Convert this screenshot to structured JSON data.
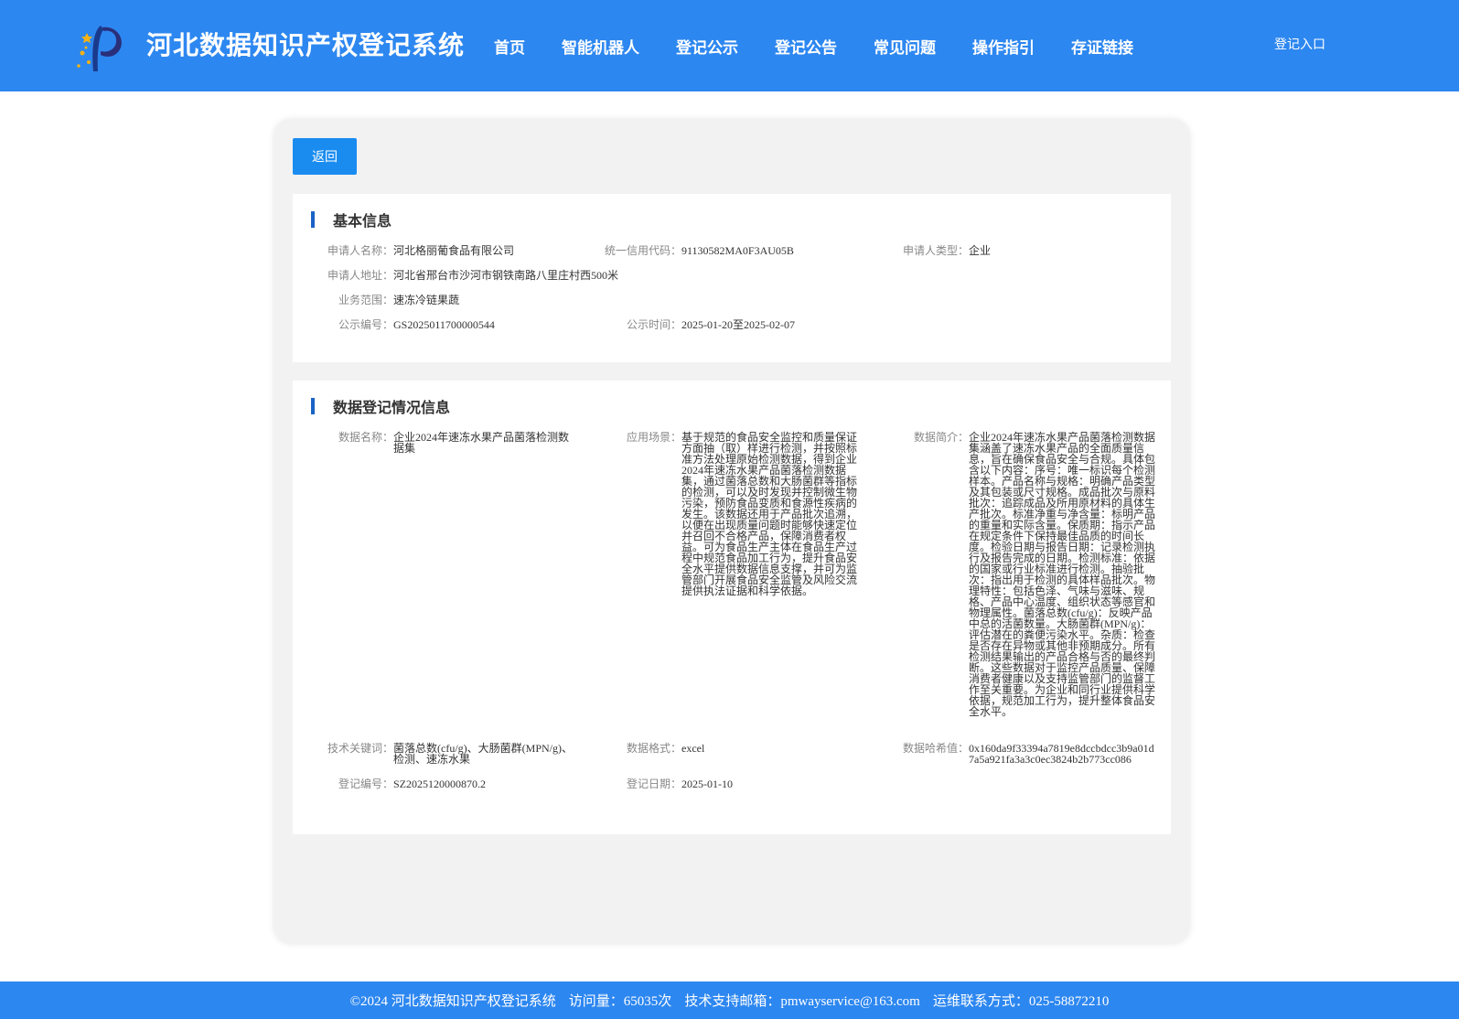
{
  "header": {
    "title": "河北数据知识产权登记系统",
    "nav": [
      "首页",
      "智能机器人",
      "登记公示",
      "登记公告",
      "常见问题",
      "操作指引",
      "存证链接"
    ],
    "login": "登记入口",
    "bg_color": "#2d87f0"
  },
  "back_label": "返回",
  "basic": {
    "title": "基本信息",
    "applicant_name_label": "申请人名称：",
    "applicant_name": "河北格丽葡食品有限公司",
    "credit_code_label": "统一信用代码：",
    "credit_code": "91130582MA0F3AU05B",
    "applicant_type_label": "申请人类型：",
    "applicant_type": "企业",
    "address_label": "申请人地址：",
    "address": "河北省邢台市沙河市钢铁南路八里庄村西500米",
    "business_label": "业务范围：",
    "business": "速冻冷链果蔬",
    "notice_no_label": "公示编号：",
    "notice_no": "GS2025011700000544",
    "notice_time_label": "公示时间：",
    "notice_time": "2025-01-20至2025-02-07"
  },
  "data_info": {
    "title": "数据登记情况信息",
    "name_label": "数据名称：",
    "name": "企业2024年速冻水果产品菌落检测数据集",
    "scene_label": "应用场景：",
    "scene": "基于规范的食品安全监控和质量保证方面抽（取）样进行检测，并按照标准方法处理原始检测数据，得到企业2024年速冻水果产品菌落检测数据集，通过菌落总数和大肠菌群等指标的检测，可以及时发现并控制微生物污染，预防食品变质和食源性疾病的发生。该数据还用于产品批次追溯，以便在出现质量问题时能够快速定位并召回不合格产品，保障消费者权益。可为食品生产主体在食品生产过程中规范食品加工行为，提升食品安全水平提供数据信息支撑，并可为监管部门开展食品安全监管及风险交流提供执法证据和科学依据。",
    "intro_label": "数据简介：",
    "intro": "企业2024年速冻水果产品菌落检测数据集涵盖了速冻水果产品的全面质量信息，旨在确保食品安全与合规。具体包含以下内容：序号：唯一标识每个检测样本。产品名称与规格：明确产品类型及其包装或尺寸规格。成品批次与原料批次：追踪成品及所用原材料的具体生产批次。标准净重与净含量：标明产品的重量和实际含量。保质期：指示产品在规定条件下保持最佳品质的时间长度。检验日期与报告日期：记录检测执行及报告完成的日期。检测标准：依据的国家或行业标准进行检测。抽验批次：指出用于检测的具体样品批次。物理特性：包括色泽、气味与滋味、规格、产品中心温度、组织状态等感官和物理属性。菌落总数(cfu/g)：反映产品中总的活菌数量。大肠菌群(MPN/g)：评估潜在的粪便污染水平。杂质：检查是否存在异物或其他非预期成分。所有检测结果输出的产品合格与否的最终判断。这些数据对于监控产品质量、保障消费者健康以及支持监管部门的监督工作至关重要。为企业和同行业提供科学依据，规范加工行为，提升整体食品安全水平。",
    "keywords_label": "技术关键词：",
    "keywords": "菌落总数(cfu/g)、大肠菌群(MPN/g)、检测、速冻水果",
    "format_label": "数据格式：",
    "format": "excel",
    "hash_label": "数据哈希值：",
    "hash": "0x160da9f33394a7819e8dccbdcc3b9a01d7a5a921fa3a3c0ec3824b2b773cc086",
    "reg_no_label": "登记编号：",
    "reg_no": "SZ2025120000870.2",
    "reg_date_label": "登记日期：",
    "reg_date": "2025-01-10"
  },
  "footer": {
    "copyright": "©2024 河北数据知识产权登记系统",
    "visits": "访问量：65035次",
    "email": "技术支持邮箱：pmwayservice@163.com",
    "contact": "运维联系方式：025-58872210"
  }
}
